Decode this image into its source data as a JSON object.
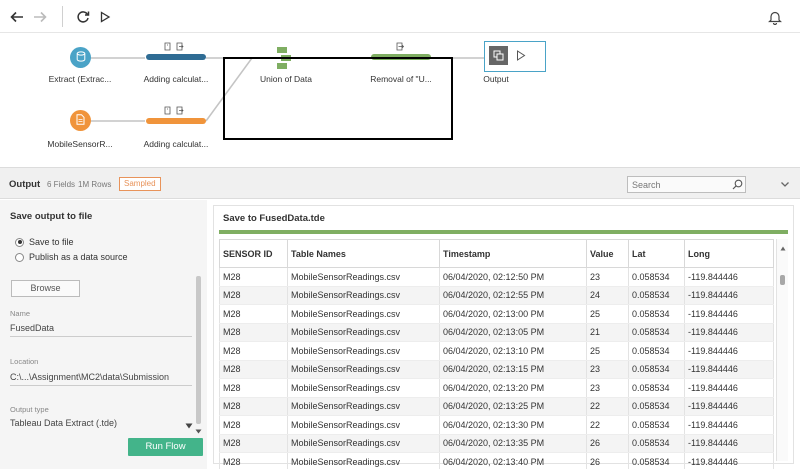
{
  "toolbar": {
    "back_icon": "arrow-left-icon",
    "forward_icon": "arrow-right-icon",
    "refresh_icon": "refresh-icon",
    "run_icon": "play-icon",
    "notification_icon": "bell-icon"
  },
  "flow": {
    "nodes": {
      "extract": {
        "label": "Extract (Extrac...",
        "color": "#4aa3c7",
        "icon": "database-icon"
      },
      "mobile_sensor": {
        "label": "MobileSensorR...",
        "color": "#f0943b",
        "icon": "file-icon"
      },
      "calc1": {
        "label": "Adding calculat...",
        "color": "#2f6c94"
      },
      "calc2": {
        "label": "Adding calculat...",
        "color": "#f0943b"
      },
      "union": {
        "label": "Union of Data",
        "color": "#7fae62",
        "icon": "union-icon"
      },
      "removal": {
        "label": "Removal of \"U...",
        "color": "#7fae62"
      },
      "output": {
        "label": "Output",
        "icon": "output-icon"
      }
    }
  },
  "panel": {
    "title": "Output",
    "fields": "6 Fields",
    "rows": "1M Rows",
    "sampled": "Sampled",
    "search_placeholder": "Search"
  },
  "settings": {
    "title": "Save output to file",
    "option_save": "Save to file",
    "option_publish": "Publish as a data source",
    "browse_label": "Browse",
    "name_label": "Name",
    "name_value": "FusedData",
    "location_label": "Location",
    "location_value": "C:\\...\\Assignment\\MC2\\data\\Submission",
    "output_type_label": "Output type",
    "output_type_value": "Tableau Data Extract (.tde)",
    "run_flow_label": "Run Flow"
  },
  "preview": {
    "title": "Save to FusedData.tde",
    "columns": [
      "SENSOR ID",
      "Table Names",
      "Timestamp",
      "Value",
      "Lat",
      "Long"
    ],
    "rows": [
      [
        "M28",
        "MobileSensorReadings.csv",
        "06/04/2020, 02:12:50 PM",
        "23",
        "0.058534",
        "-119.844446"
      ],
      [
        "M28",
        "MobileSensorReadings.csv",
        "06/04/2020, 02:12:55 PM",
        "24",
        "0.058534",
        "-119.844446"
      ],
      [
        "M28",
        "MobileSensorReadings.csv",
        "06/04/2020, 02:13:00 PM",
        "25",
        "0.058534",
        "-119.844446"
      ],
      [
        "M28",
        "MobileSensorReadings.csv",
        "06/04/2020, 02:13:05 PM",
        "21",
        "0.058534",
        "-119.844446"
      ],
      [
        "M28",
        "MobileSensorReadings.csv",
        "06/04/2020, 02:13:10 PM",
        "25",
        "0.058534",
        "-119.844446"
      ],
      [
        "M28",
        "MobileSensorReadings.csv",
        "06/04/2020, 02:13:15 PM",
        "23",
        "0.058534",
        "-119.844446"
      ],
      [
        "M28",
        "MobileSensorReadings.csv",
        "06/04/2020, 02:13:20 PM",
        "23",
        "0.058534",
        "-119.844446"
      ],
      [
        "M28",
        "MobileSensorReadings.csv",
        "06/04/2020, 02:13:25 PM",
        "22",
        "0.058534",
        "-119.844446"
      ],
      [
        "M28",
        "MobileSensorReadings.csv",
        "06/04/2020, 02:13:30 PM",
        "22",
        "0.058534",
        "-119.844446"
      ],
      [
        "M28",
        "MobileSensorReadings.csv",
        "06/04/2020, 02:13:35 PM",
        "26",
        "0.058534",
        "-119.844446"
      ],
      [
        "M28",
        "MobileSensorReadings.csv",
        "06/04/2020, 02:13:40 PM",
        "26",
        "0.058534",
        "-119.844446"
      ]
    ]
  }
}
